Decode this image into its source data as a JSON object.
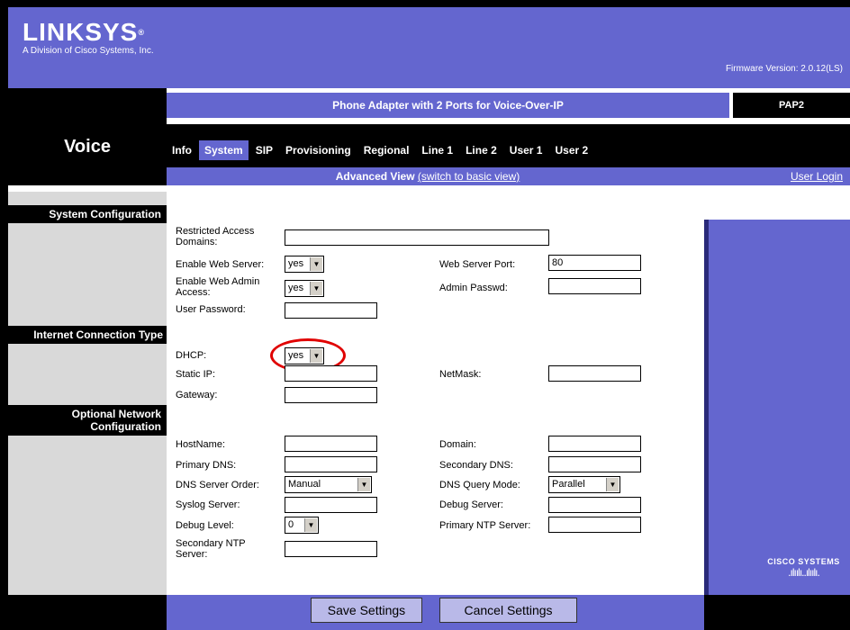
{
  "header": {
    "brand": "LINKSYS",
    "registered": "®",
    "tagline": "A Division of Cisco Systems, Inc.",
    "firmware": "Firmware Version: 2.0.12(LS)",
    "section": "Voice",
    "product": "Phone Adapter with 2 Ports for Voice-Over-IP",
    "model": "PAP2"
  },
  "tabs": [
    "Info",
    "System",
    "SIP",
    "Provisioning",
    "Regional",
    "Line 1",
    "Line 2",
    "User 1",
    "User 2"
  ],
  "active_tab": "System",
  "view": {
    "current": "Advanced View",
    "switch_link": "(switch to basic view)",
    "user_login": "User Login"
  },
  "sections": {
    "system_config": "System Configuration",
    "internet_connection": "Internet Connection Type",
    "optional_network_1": "Optional Network",
    "optional_network_2": "Configuration"
  },
  "fields": {
    "restricted_access_l1": "Restricted Access",
    "restricted_access_l2": "Domains:",
    "restricted_access_value": "",
    "enable_web_server": "Enable Web Server:",
    "enable_web_server_value": "yes",
    "web_server_port": "Web Server Port:",
    "web_server_port_value": "80",
    "enable_web_admin_l1": "Enable Web Admin",
    "enable_web_admin_l2": "Access:",
    "enable_web_admin_value": "yes",
    "admin_passwd": "Admin Passwd:",
    "admin_passwd_value": "",
    "user_password": "User Password:",
    "user_password_value": "",
    "dhcp": "DHCP:",
    "dhcp_value": "yes",
    "static_ip": "Static IP:",
    "static_ip_value": "",
    "netmask": "NetMask:",
    "netmask_value": "",
    "gateway": "Gateway:",
    "gateway_value": "",
    "hostname": "HostName:",
    "hostname_value": "",
    "domain": "Domain:",
    "domain_value": "",
    "primary_dns": "Primary DNS:",
    "primary_dns_value": "",
    "secondary_dns": "Secondary DNS:",
    "secondary_dns_value": "",
    "dns_server_order": "DNS Server Order:",
    "dns_server_order_value": "Manual",
    "dns_query_mode": "DNS Query Mode:",
    "dns_query_mode_value": "Parallel",
    "syslog_server": "Syslog Server:",
    "syslog_server_value": "",
    "debug_server": "Debug Server:",
    "debug_server_value": "",
    "debug_level": "Debug Level:",
    "debug_level_value": "0",
    "primary_ntp": "Primary NTP Server:",
    "primary_ntp_value": "",
    "secondary_ntp_l1": "Secondary NTP",
    "secondary_ntp_l2": "Server:",
    "secondary_ntp_value": ""
  },
  "buttons": {
    "save": "Save Settings",
    "cancel": "Cancel Settings"
  },
  "footer": {
    "cisco": "CISCO SYSTEMS"
  },
  "colors": {
    "accent": "#6466cf",
    "sidebar": "#d9d9d9",
    "annotation": "#e00000"
  },
  "icons": [
    "dropdown-arrow-icon",
    "cisco-logo-icon",
    "linksys-logo"
  ]
}
